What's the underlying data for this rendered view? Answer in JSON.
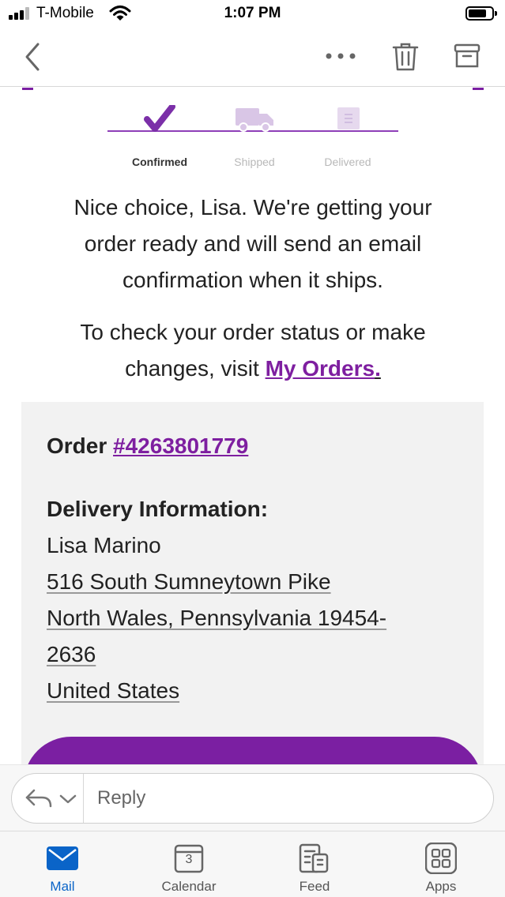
{
  "status_bar": {
    "carrier": "T-Mobile",
    "time": "1:07 PM"
  },
  "nav": {
    "back_icon": "chevron-left-icon",
    "more_icon": "more-dots-icon",
    "delete_icon": "trash-icon",
    "archive_icon": "archive-icon"
  },
  "tracker": {
    "steps": [
      {
        "label": "Confirmed",
        "state": "active",
        "icon": "checkmark-icon"
      },
      {
        "label": "Shipped",
        "state": "inactive",
        "icon": "truck-icon"
      },
      {
        "label": "Delivered",
        "state": "inactive",
        "icon": "package-icon"
      }
    ]
  },
  "message": {
    "line1": "Nice choice, Lisa. We're getting your",
    "line2": "order ready and will send an email",
    "line3": "confirmation when it ships.",
    "check_line1": "To check your order status or make",
    "check_line2_prefix": "changes, visit ",
    "my_orders_link": "My Orders",
    "link_suffix": "."
  },
  "order": {
    "label": "Order ",
    "number": "#4263801779",
    "delivery_heading": "Delivery Information:",
    "name": "Lisa Marino",
    "street": "516 South Sumneytown Pike",
    "city_line": "North Wales, Pennsylvania 19454-",
    "zip_ext": "2636",
    "country": "United States"
  },
  "reply": {
    "placeholder": "Reply"
  },
  "tabs": [
    {
      "label": "Mail",
      "icon": "mail-icon",
      "active": true
    },
    {
      "label": "Calendar",
      "icon": "calendar-icon",
      "active": false,
      "day": "3"
    },
    {
      "label": "Feed",
      "icon": "feed-icon",
      "active": false
    },
    {
      "label": "Apps",
      "icon": "apps-icon",
      "active": false
    }
  ],
  "colors": {
    "brand_purple": "#7b1fa2",
    "link_purple": "#7e1fa0",
    "tab_active": "#0a64c8"
  }
}
